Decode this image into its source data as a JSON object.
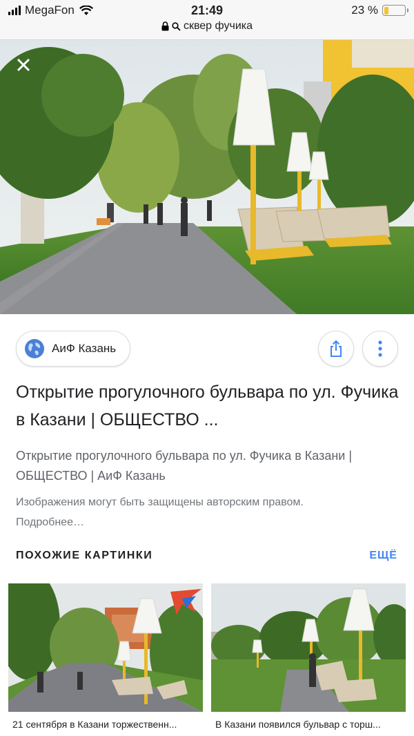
{
  "status_bar": {
    "carrier": "MegaFon",
    "time": "21:49",
    "battery": "23 %",
    "battery_level": 0.23
  },
  "url_bar": {
    "query": "сквер фучика"
  },
  "result": {
    "source": "АиФ Казань",
    "title": "Открытие прогулочного бульвара по ул. Фучика в Казани | ОБЩЕСТВО ...",
    "subtitle": "Открытие прогулочного бульвара по ул. Фучика в Казани | ОБЩЕСТВО | АиФ Казань",
    "copyright": "Изображения могут быть защищены авторским правом. Подробнее…"
  },
  "related": {
    "heading": "ПОХОЖИЕ КАРТИНКИ",
    "more": "ЕЩЁ",
    "items": [
      {
        "caption": "21 сентября в Казани торжественн..."
      },
      {
        "caption": "В Казани появился бульвар с торш..."
      }
    ]
  },
  "colors": {
    "accent": "#4285f4",
    "lamp_yellow": "#e8b92a",
    "grass": "#4f8a2c",
    "path": "#8e8f93"
  },
  "icons": {
    "close": "close-icon",
    "lock": "lock-icon",
    "globe": "globe-icon",
    "share": "share-icon",
    "more": "more-vert-icon"
  }
}
